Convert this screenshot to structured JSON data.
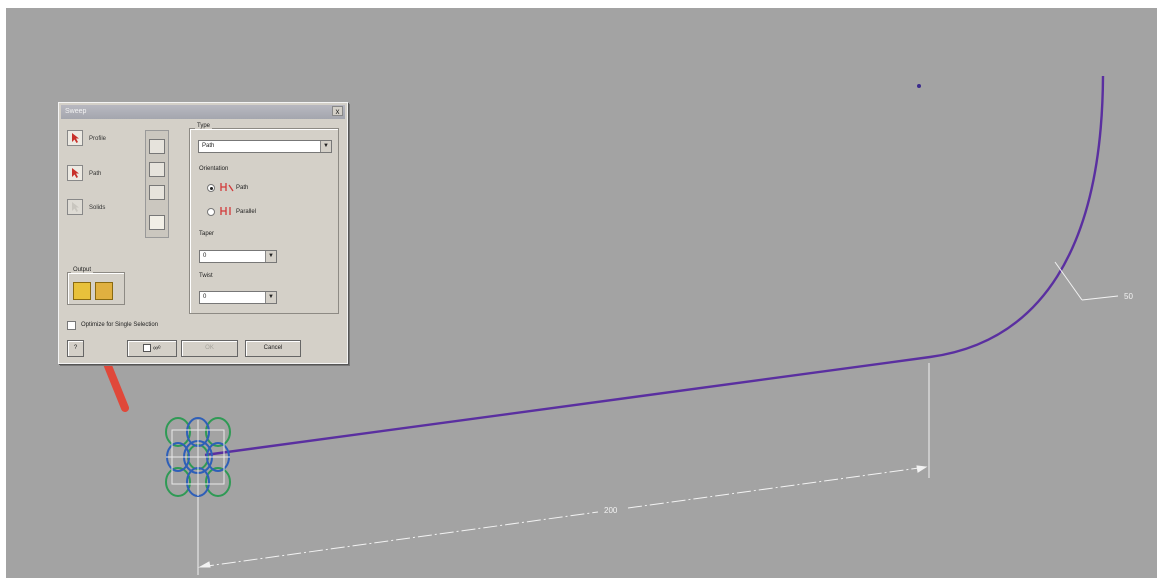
{
  "dialog": {
    "title": "Sweep",
    "close": "x",
    "selectors": [
      {
        "label": "Profile"
      },
      {
        "label": "Path"
      },
      {
        "label": "Solids"
      }
    ],
    "type": {
      "label": "Type",
      "value": "Path",
      "options": [
        "Path"
      ]
    },
    "orientation": {
      "label": "Orientation",
      "options": [
        {
          "label": "Path",
          "selected": true
        },
        {
          "label": "Parallel",
          "selected": false
        }
      ]
    },
    "taper": {
      "label": "Taper",
      "value": "0"
    },
    "twist": {
      "label": "Twist",
      "value": "0"
    },
    "output": {
      "label": "Output"
    },
    "optimize": {
      "label": "Optimize for Single Selection",
      "checked": false
    },
    "ok": "OK",
    "cancel": "Cancel",
    "help": "?"
  },
  "sketch": {
    "dimension_length": "200",
    "dimension_radius": "50",
    "path_color": "#5a2fa0",
    "arrow_color": "#e0483a",
    "profile_colors": [
      "#2e5fb8",
      "#2f9a55"
    ]
  }
}
